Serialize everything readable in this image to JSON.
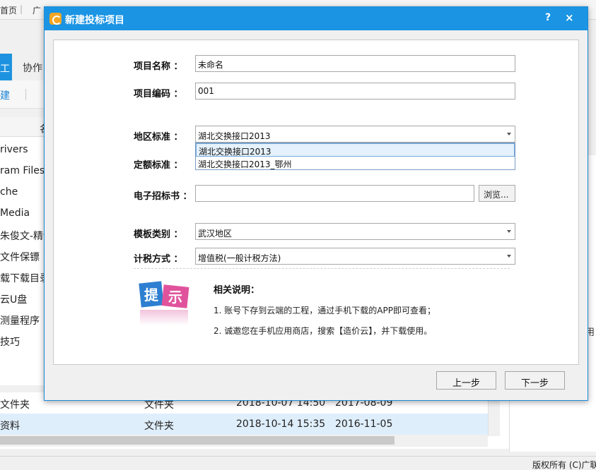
{
  "background": {
    "topbar": {
      "home": "首页",
      "separator": "|",
      "site": "广"
    },
    "tabs": {
      "active": "工",
      "collab": "协作"
    },
    "toolbar": {
      "new": "建"
    },
    "sort_header": "名",
    "left_items": [
      "rivers",
      "ram Files",
      "che",
      "Media",
      "朱俊文-精讯",
      "文件保镖",
      "载下载目录",
      "云U盘",
      "测量程序",
      "技巧"
    ],
    "rows": [
      {
        "name": "文件夹",
        "type": "文件夹",
        "modified": "2018-10-07 14:50",
        "created": "2017-08-09"
      },
      {
        "name": "资料",
        "type": "文件夹",
        "modified": "2018-10-14 15:35",
        "created": "2016-11-05"
      }
    ],
    "footer": "版权所有 (C)广联",
    "right_text": "用"
  },
  "dialog": {
    "title": "新建投标项目",
    "help": "?",
    "close": "×",
    "fields": {
      "project_name_label": "项目名称 ：",
      "project_name_value": "未命名",
      "project_code_label": "项目编码 ：",
      "project_code_value": "001",
      "region_label": "地区标准 ：",
      "region_value": "湖北交换接口2013",
      "region_options": [
        "湖北交换接口2013",
        "湖北交换接口2013_鄂州"
      ],
      "quota_label": "定额标准 ：",
      "tender_doc_label": "电子招标书 ：",
      "tender_doc_value": "",
      "browse": "浏览...",
      "template_label": "模板类别 ：",
      "template_value": "武汉地区",
      "tax_label": "计税方式 ：",
      "tax_value": "增值税(一般计税方法)"
    },
    "tips": {
      "icon_text": "提示",
      "title": "相关说明：",
      "lines": [
        "1.  账号下存到云端的工程，通过手机下载的APP即可查看；",
        "2.  诚邀您在手机应用商店，搜索【造价云】，并下载使用。"
      ]
    },
    "buttons": {
      "prev": "上一步",
      "next": "下一步"
    }
  }
}
